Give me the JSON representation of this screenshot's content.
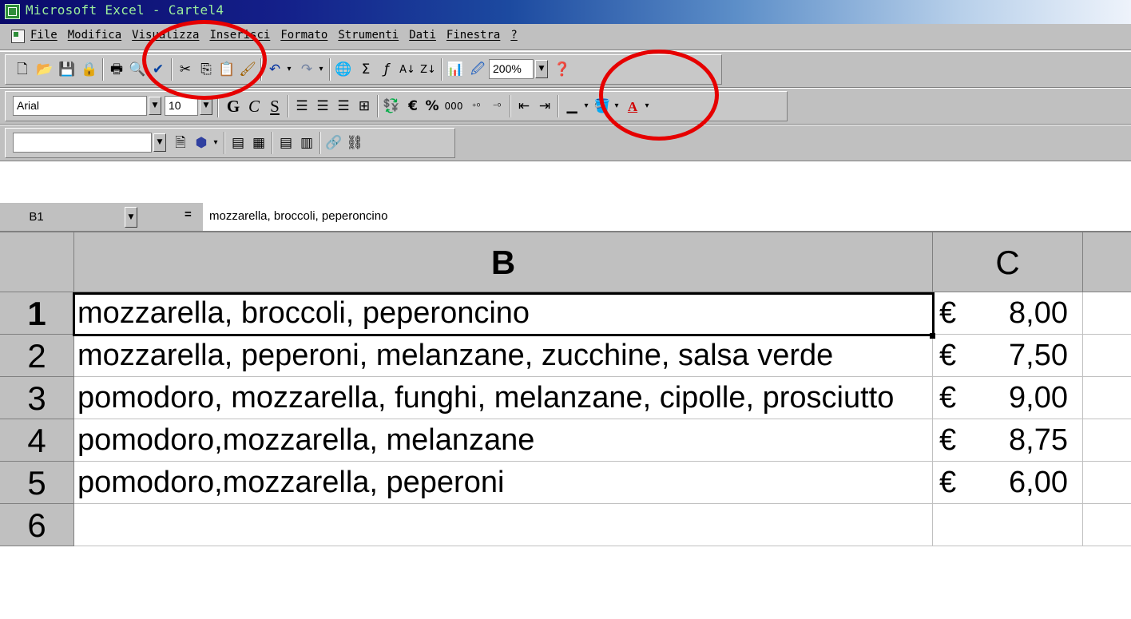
{
  "window": {
    "title": "Microsoft Excel - Cartel4"
  },
  "menu": {
    "items": [
      "File",
      "Modifica",
      "Visualizza",
      "Inserisci",
      "Formato",
      "Strumenti",
      "Dati",
      "Finestra",
      "?"
    ]
  },
  "standard_toolbar": {
    "zoom_value": "200%"
  },
  "formatting_toolbar": {
    "font_name": "Arial",
    "font_size": "10",
    "bold_label": "G",
    "italic_label": "C",
    "underline_label": "S",
    "euro_label": "€",
    "percent_label": "%",
    "thousands_label": "000"
  },
  "formula_bar": {
    "cell_ref": "B1",
    "equals": "=",
    "content": "mozzarella, broccoli, peperoncino"
  },
  "sheet": {
    "columns": [
      "B",
      "C"
    ],
    "rows": [
      {
        "num": "1",
        "B": "mozzarella, broccoli, peperoncino",
        "currency": "€",
        "C": "8,00"
      },
      {
        "num": "2",
        "B": "mozzarella, peperoni, melanzane, zucchine, salsa verde",
        "currency": "€",
        "C": "7,50"
      },
      {
        "num": "3",
        "B": "pomodoro, mozzarella, funghi, melanzane, cipolle, prosciutto",
        "currency": "€",
        "C": "9,00"
      },
      {
        "num": "4",
        "B": "pomodoro,mozzarella, melanzane",
        "currency": "€",
        "C": "8,75"
      },
      {
        "num": "5",
        "B": "pomodoro,mozzarella, peperoni",
        "currency": "€",
        "C": "6,00"
      },
      {
        "num": "6",
        "B": "",
        "currency": "",
        "C": ""
      }
    ],
    "active_cell": "B1"
  },
  "annotations": {
    "circle_color": "#e60000"
  }
}
